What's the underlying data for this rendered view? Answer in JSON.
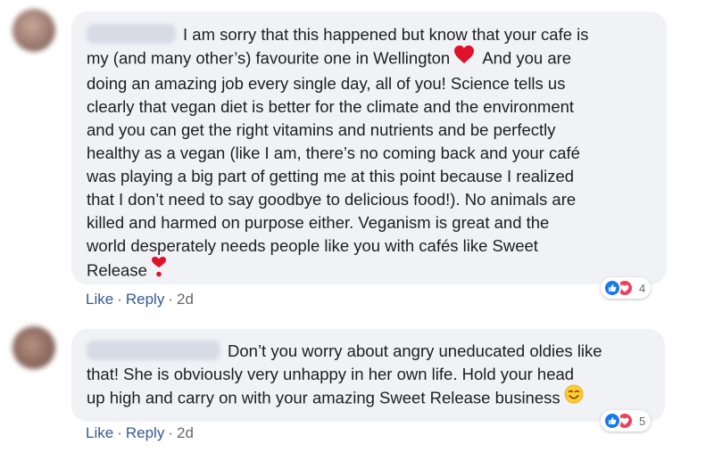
{
  "comments": [
    {
      "author": "",
      "text_before_heart": "I am sorry that this happened but know that your cafe is\nmy (and many other’s) favourite one in Wellington",
      "text_after_heart": " And you are\ndoing an amazing job every single day, all of you! Science tells us\nclearly that vegan diet is better for the climate and the environment\nand you can get the right vitamins and nutrients and be perfectly\nhealthy as a vegan (like I am, there’s no coming back and your café\nwas playing a big part of getting me at this point because I realized\nthat I don’t need to say goodbye to delicious food!). No animals are\nkilled and harmed on purpose either. Veganism is great and the\nworld desperately needs people like you with cafés like Sweet\nRelease",
      "emoji_1": "heart-emoji",
      "emoji_2": "heart-exclamation-emoji",
      "like_label": "Like",
      "separator": "·",
      "reply_label": "Reply",
      "time": "2d",
      "reaction_count": "4",
      "reaction_icons": [
        "like-icon",
        "love-icon"
      ]
    },
    {
      "author": "",
      "text": "Don’t you worry about angry uneducated oldies like\nthat! She is obviously very unhappy in her own life. Hold your head\nup high and carry on with your amazing Sweet Release business",
      "emoji_1": "smiling-face-emoji",
      "like_label": "Like",
      "separator": "·",
      "reply_label": "Reply",
      "time": "2d",
      "reaction_count": "5",
      "reaction_icons": [
        "like-icon",
        "love-icon"
      ]
    }
  ],
  "colors": {
    "bubble_bg": "#f0f2f5",
    "link": "#385898",
    "meta": "#65676b",
    "like_blue": "#1877f2",
    "love_red": "#f33e58"
  }
}
